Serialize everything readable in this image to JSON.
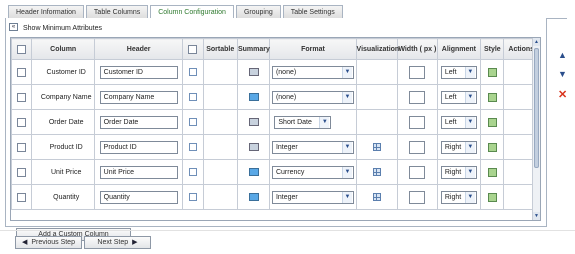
{
  "tabs": [
    {
      "label": "Header Information",
      "active": false
    },
    {
      "label": "Table Columns",
      "active": false
    },
    {
      "label": "Column Configuration",
      "active": true
    },
    {
      "label": "Grouping",
      "active": false
    },
    {
      "label": "Table Settings",
      "active": false
    }
  ],
  "panel": {
    "collapse_symbol": "«",
    "show_min_label": "Show Minimum Attributes"
  },
  "grid": {
    "headers": {
      "column": "Column",
      "header": "Header",
      "sortable": "Sortable",
      "summary": "Summary",
      "format": "Format",
      "visualization": "Visualization",
      "width": "Width ( px )",
      "alignment": "Alignment",
      "style": "Style",
      "actions": "Actions"
    },
    "rows": [
      {
        "column": "Customer ID",
        "header": "Customer ID",
        "summary_active": false,
        "format": "(none)",
        "has_visualization": false,
        "alignment": "Left"
      },
      {
        "column": "Company Name",
        "header": "Company Name",
        "summary_active": true,
        "format": "(none)",
        "has_visualization": false,
        "alignment": "Left"
      },
      {
        "column": "Order Date",
        "header": "Order Date",
        "summary_active": false,
        "format": "Short Date",
        "has_visualization": false,
        "alignment": "Left"
      },
      {
        "column": "Product ID",
        "header": "Product ID",
        "summary_active": false,
        "format": "Integer",
        "has_visualization": true,
        "alignment": "Right"
      },
      {
        "column": "Unit Price",
        "header": "Unit Price",
        "summary_active": true,
        "format": "Currency",
        "has_visualization": true,
        "alignment": "Right"
      },
      {
        "column": "Quantity",
        "header": "Quantity",
        "summary_active": true,
        "format": "Integer",
        "has_visualization": true,
        "alignment": "Right"
      }
    ]
  },
  "side_actions": {
    "move_up": "▲",
    "move_down": "▼",
    "delete": "✕"
  },
  "buttons": {
    "add_column": "Add a Custom Column",
    "previous": "Previous Step",
    "next": "Next Step"
  },
  "icons": {
    "prev_arrow": "◀",
    "next_arrow": "▶",
    "dropdown": "▼"
  },
  "colors": {
    "active_tab_text": "#2f7a2f",
    "delete_icon": "#d9331c",
    "arrow_icon": "#2b4f8c"
  }
}
